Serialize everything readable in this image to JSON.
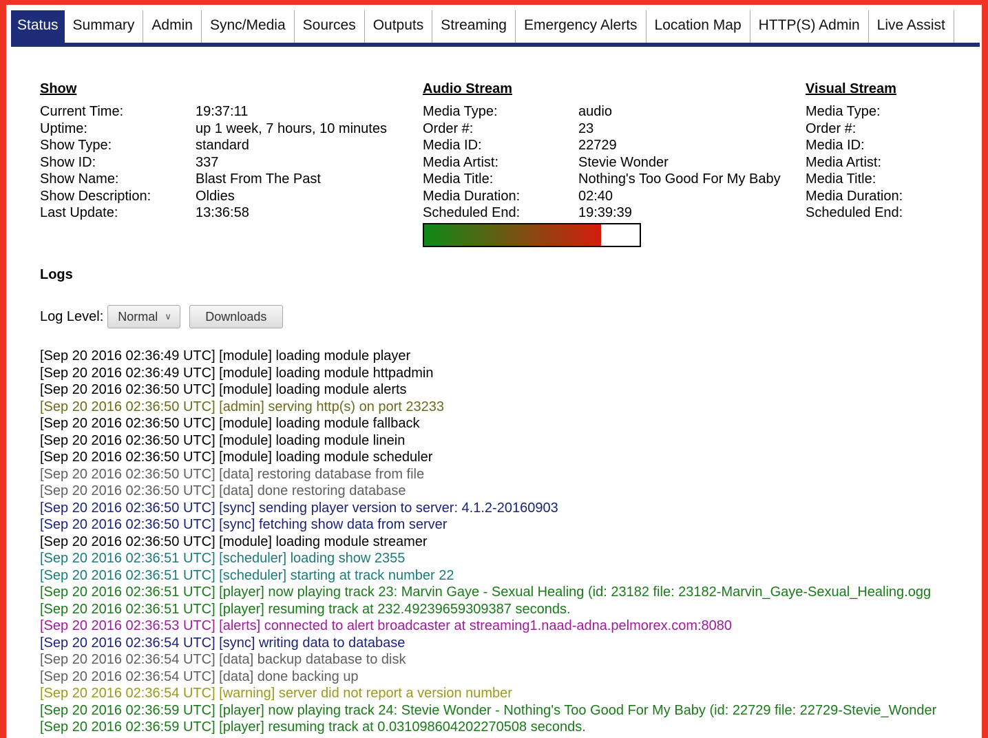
{
  "colors": {
    "frame": "#ef3324",
    "tab_active_bg": "#1e2d7a",
    "progress_start": "#0f8a1a",
    "progress_end": "#d41c0c"
  },
  "tabs": [
    {
      "label": "Status",
      "active": true
    },
    {
      "label": "Summary"
    },
    {
      "label": "Admin"
    },
    {
      "label": "Sync/Media"
    },
    {
      "label": "Sources"
    },
    {
      "label": "Outputs"
    },
    {
      "label": "Streaming"
    },
    {
      "label": "Emergency Alerts"
    },
    {
      "label": "Location Map"
    },
    {
      "label": "HTTP(S) Admin"
    },
    {
      "label": "Live Assist"
    }
  ],
  "show": {
    "title": "Show",
    "fields": [
      {
        "k": "Current Time:",
        "v": "19:37:11"
      },
      {
        "k": "Uptime:",
        "v": "up 1 week, 7 hours, 10 minutes"
      },
      {
        "k": "Show Type:",
        "v": "standard"
      },
      {
        "k": "Show ID:",
        "v": "337"
      },
      {
        "k": "Show Name:",
        "v": "Blast From The Past"
      },
      {
        "k": "Show Description:",
        "v": "Oldies"
      },
      {
        "k": "Last Update:",
        "v": "13:36:58"
      }
    ]
  },
  "audio": {
    "title": "Audio Stream",
    "fields": [
      {
        "k": "Media Type:",
        "v": "audio"
      },
      {
        "k": "Order #:",
        "v": "23"
      },
      {
        "k": "Media ID:",
        "v": "22729"
      },
      {
        "k": "Media Artist:",
        "v": "Stevie Wonder"
      },
      {
        "k": "Media Title:",
        "v": "Nothing's Too Good For My Baby"
      },
      {
        "k": "Media Duration:",
        "v": "02:40"
      },
      {
        "k": "Scheduled End:",
        "v": "19:39:39"
      }
    ],
    "progress_fraction": 0.82
  },
  "visual": {
    "title": "Visual Stream",
    "fields": [
      {
        "k": "Media Type:",
        "v": ""
      },
      {
        "k": "Order #:",
        "v": ""
      },
      {
        "k": "Media ID:",
        "v": ""
      },
      {
        "k": "Media Artist:",
        "v": ""
      },
      {
        "k": "Media Title:",
        "v": ""
      },
      {
        "k": "Media Duration:",
        "v": ""
      },
      {
        "k": "Scheduled End:",
        "v": ""
      }
    ]
  },
  "logs": {
    "title": "Logs",
    "level_label": "Log Level:",
    "level_value": "Normal",
    "downloads_label": "Downloads",
    "lines": [
      {
        "text": "[Sep 20 2016 02:36:49 UTC] [module] loading module player",
        "color": "#000000"
      },
      {
        "text": "[Sep 20 2016 02:36:49 UTC] [module] loading module httpadmin",
        "color": "#000000"
      },
      {
        "text": "[Sep 20 2016 02:36:50 UTC] [module] loading module alerts",
        "color": "#000000"
      },
      {
        "text": "[Sep 20 2016 02:36:50 UTC] [admin] serving http(s) on port 23233",
        "color": "#6b6b1c"
      },
      {
        "text": "[Sep 20 2016 02:36:50 UTC] [module] loading module fallback",
        "color": "#000000"
      },
      {
        "text": "[Sep 20 2016 02:36:50 UTC] [module] loading module linein",
        "color": "#000000"
      },
      {
        "text": "[Sep 20 2016 02:36:50 UTC] [module] loading module scheduler",
        "color": "#000000"
      },
      {
        "text": "[Sep 20 2016 02:36:50 UTC] [data] restoring database from file",
        "color": "#606060"
      },
      {
        "text": "[Sep 20 2016 02:36:50 UTC] [data] done restoring database",
        "color": "#606060"
      },
      {
        "text": "[Sep 20 2016 02:36:50 UTC] [sync] sending player version to server: 4.1.2-20160903",
        "color": "#1a237e"
      },
      {
        "text": "[Sep 20 2016 02:36:50 UTC] [sync] fetching show data from server",
        "color": "#1a237e"
      },
      {
        "text": "[Sep 20 2016 02:36:50 UTC] [module] loading module streamer",
        "color": "#000000"
      },
      {
        "text": "[Sep 20 2016 02:36:51 UTC] [scheduler] loading show 2355",
        "color": "#1b7a7a"
      },
      {
        "text": "[Sep 20 2016 02:36:51 UTC] [scheduler] starting at track number 22",
        "color": "#1b7a7a"
      },
      {
        "text": "[Sep 20 2016 02:36:51 UTC] [player] now playing track 23: Marvin Gaye - Sexual Healing (id: 23182 file: 23182-Marvin_Gaye-Sexual_Healing.ogg",
        "color": "#1a7a1a"
      },
      {
        "text": "[Sep 20 2016 02:36:51 UTC] [player] resuming track at 232.49239659309387 seconds.",
        "color": "#1a7a1a"
      },
      {
        "text": "[Sep 20 2016 02:36:53 UTC] [alerts] connected to alert broadcaster at streaming1.naad-adna.pelmorex.com:8080",
        "color": "#a21aa2"
      },
      {
        "text": "[Sep 20 2016 02:36:54 UTC] [sync] writing data to database",
        "color": "#1a237e"
      },
      {
        "text": "[Sep 20 2016 02:36:54 UTC] [data] backup database to disk",
        "color": "#606060"
      },
      {
        "text": "[Sep 20 2016 02:36:54 UTC] [data] done backing up",
        "color": "#606060"
      },
      {
        "text": "[Sep 20 2016 02:36:54 UTC] [warning] server did not report a version number",
        "color": "#9a9a1a"
      },
      {
        "text": "[Sep 20 2016 02:36:59 UTC] [player] now playing track 24: Stevie Wonder - Nothing's Too Good For My Baby (id: 22729 file: 22729-Stevie_Wonder",
        "color": "#1a7a1a"
      },
      {
        "text": "[Sep 20 2016 02:36:59 UTC] [player] resuming track at 0.031098604202270508 seconds.",
        "color": "#1a7a1a"
      }
    ]
  }
}
